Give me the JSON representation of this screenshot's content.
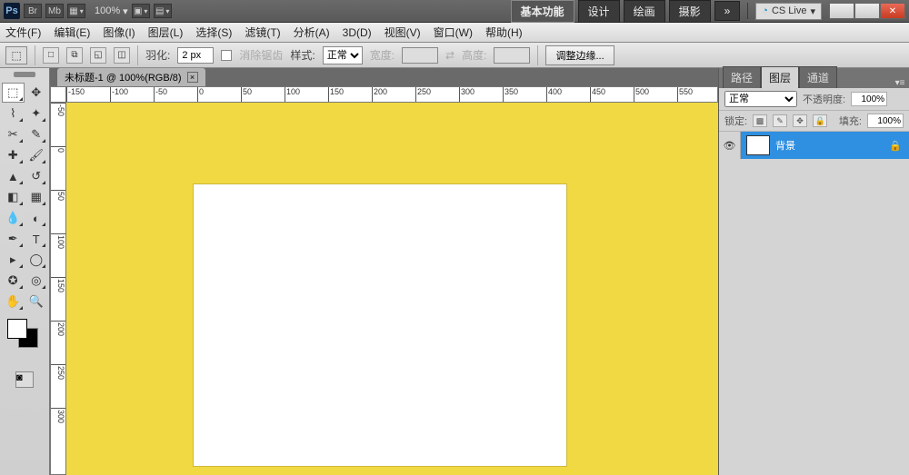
{
  "titlebar": {
    "ps": "Ps",
    "br": "Br",
    "mb": "Mb",
    "zoom": "100%",
    "workspaces": {
      "active": "基本功能",
      "items": [
        "设计",
        "绘画",
        "摄影"
      ],
      "more": "»"
    },
    "cslive": "CS Live",
    "dash": "▾"
  },
  "menu": [
    "文件(F)",
    "编辑(E)",
    "图像(I)",
    "图层(L)",
    "选择(S)",
    "滤镜(T)",
    "分析(A)",
    "3D(D)",
    "视图(V)",
    "窗口(W)",
    "帮助(H)"
  ],
  "options": {
    "feather_label": "羽化:",
    "feather_value": "2 px",
    "aa_label": "消除锯齿",
    "style_label": "样式:",
    "style_value": "正常",
    "width_label": "宽度:",
    "height_label": "高度:",
    "refine": "调整边缘..."
  },
  "doc": {
    "tab": "未标题-1 @ 100%(RGB/8)"
  },
  "ruler_h": [
    -150,
    -100,
    -50,
    0,
    50,
    100,
    150,
    200,
    250,
    300,
    350,
    400,
    450,
    500,
    550
  ],
  "ruler_v": [
    -50,
    0,
    50,
    100,
    150,
    200,
    250,
    300
  ],
  "panels": {
    "tabs": [
      "路径",
      "图层",
      "通道"
    ],
    "blend": "正常",
    "opacity_label": "不透明度:",
    "opacity": "100%",
    "lock_label": "锁定:",
    "fill_label": "填充:",
    "fill": "100%",
    "layer_name": "背景"
  }
}
